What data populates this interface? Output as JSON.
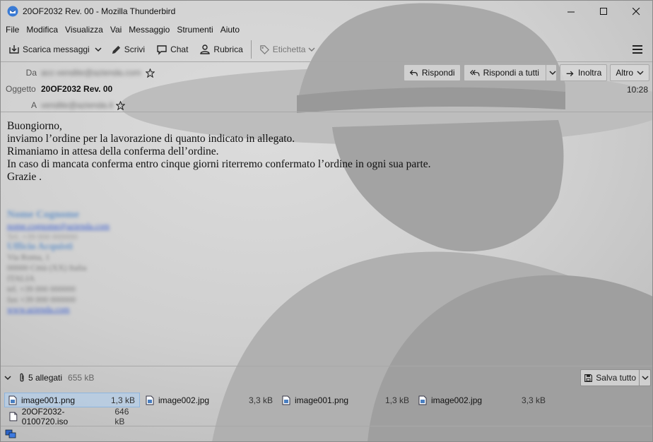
{
  "window": {
    "title": "20OF2032 Rev. 00 - Mozilla Thunderbird"
  },
  "menu": [
    "File",
    "Modifica",
    "Visualizza",
    "Vai",
    "Messaggio",
    "Strumenti",
    "Aiuto"
  ],
  "toolbar": {
    "get_messages": "Scarica messaggi",
    "write": "Scrivi",
    "chat": "Chat",
    "address_book": "Rubrica",
    "tag": "Etichetta"
  },
  "header": {
    "from_label": "Da",
    "from_value": "acc-vendite@azienda.com",
    "subject_label": "Oggetto",
    "subject_value": "20OF2032 Rev. 00",
    "to_label": "A",
    "to_value": "vendite@azienda.it",
    "time": "10:28",
    "reply": "Rispondi",
    "reply_all": "Rispondi a tutti",
    "forward": "Inoltra",
    "other": "Altro"
  },
  "body": {
    "lines": [
      "Buongiorno,",
      "inviamo l’ordine per la lavorazione di quanto indicato in allegato.",
      "Rimaniamo in attesa della conferma dell’ordine.",
      "In caso di mancata conferma entro cinque giorni riterremo confermato l’ordine in ogni sua parte.",
      "Grazie ."
    ],
    "signature": [
      "Nome Cognome",
      "nome.cognome@azienda.com",
      "Tel. +39 000 000000",
      "Ufficio Acquisti",
      "Via Roma, 1",
      "00000 Città (XX) Italia",
      "ITALIA",
      "tel. +39 000 000000",
      "fax +39 000 000000",
      "www.azienda.com"
    ]
  },
  "attachments": {
    "count_label": "5 allegati",
    "total_size": "655 kB",
    "save_all": "Salva tutto",
    "items": [
      {
        "name": "image001.png",
        "size": "1,3 kB"
      },
      {
        "name": "image002.jpg",
        "size": "3,3 kB"
      },
      {
        "name": "image001.png",
        "size": "1,3 kB"
      },
      {
        "name": "image002.jpg",
        "size": "3,3 kB"
      },
      {
        "name": "20OF2032-0100720.iso",
        "size": "646 kB"
      }
    ]
  },
  "colors": {
    "background": "#c9c9c9",
    "selection": "#b4cde8",
    "link_blur": "#6a95c8"
  }
}
